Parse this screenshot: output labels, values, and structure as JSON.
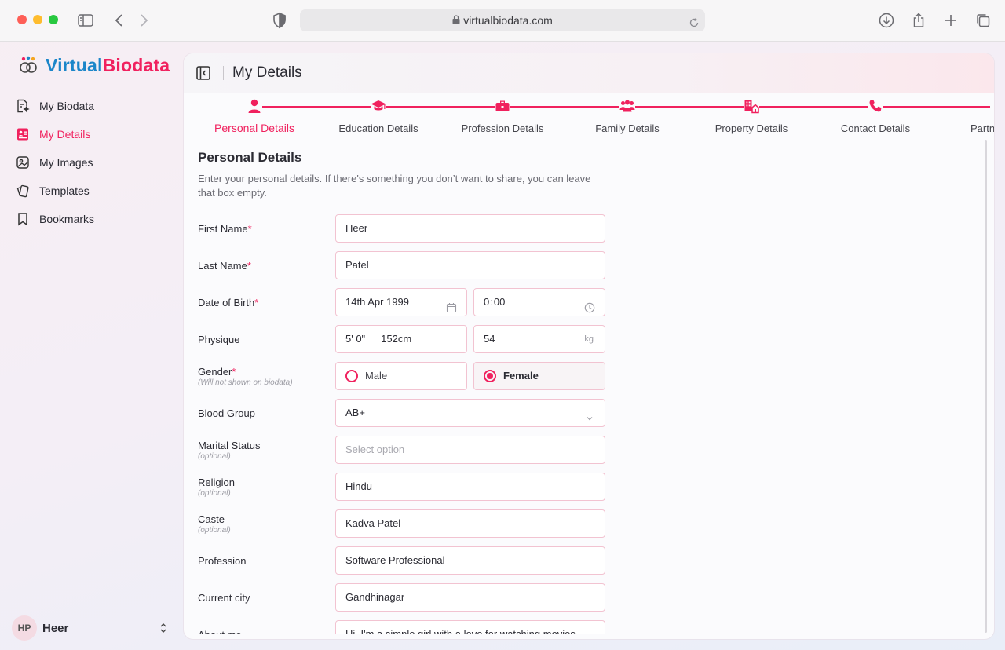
{
  "browser": {
    "url": "virtualbiodata.com"
  },
  "brand": {
    "part1": "Virtual",
    "part2": "Biodata"
  },
  "sidebar": {
    "items": [
      {
        "label": "My Biodata",
        "icon": "biodata-icon"
      },
      {
        "label": "My Details",
        "icon": "details-icon",
        "active": true
      },
      {
        "label": "My Images",
        "icon": "images-icon"
      },
      {
        "label": "Templates",
        "icon": "templates-icon"
      },
      {
        "label": "Bookmarks",
        "icon": "bookmark-icon"
      }
    ],
    "user": {
      "initials": "HP",
      "name": "Heer"
    }
  },
  "header": {
    "title": "My Details"
  },
  "steps": [
    {
      "label": "Personal Details",
      "icon": "person-icon",
      "active": true
    },
    {
      "label": "Education Details",
      "icon": "graduation-cap-icon"
    },
    {
      "label": "Profession Details",
      "icon": "briefcase-icon"
    },
    {
      "label": "Family Details",
      "icon": "family-icon"
    },
    {
      "label": "Property Details",
      "icon": "building-icon"
    },
    {
      "label": "Contact Details",
      "icon": "phone-icon"
    },
    {
      "label": "Partner",
      "icon": "partner-icon"
    }
  ],
  "form": {
    "title": "Personal Details",
    "description": "Enter your personal details. If there's something you don’t want to share, you can leave that box empty.",
    "required_mark": "*",
    "fields": {
      "first_name": {
        "label": "First Name",
        "value": "Heer"
      },
      "last_name": {
        "label": "Last Name",
        "value": "Patel"
      },
      "dob": {
        "label": "Date of Birth",
        "date": "14th Apr 1999",
        "time_hour": "0",
        "time_sep": ":",
        "time_min": "00"
      },
      "physique": {
        "label": "Physique",
        "height_ft": "5' 0\"",
        "height_cm": "152cm",
        "weight": "54",
        "weight_unit": "kg"
      },
      "gender": {
        "label": "Gender",
        "hint": "(Will not shown on biodata)",
        "option_male": "Male",
        "option_female": "Female",
        "selected": "Female"
      },
      "blood_group": {
        "label": "Blood Group",
        "value": "AB+"
      },
      "marital_status": {
        "label": "Marital Status",
        "hint": "(optional)",
        "placeholder": "Select option"
      },
      "religion": {
        "label": "Religion",
        "hint": "(optional)",
        "value": "Hindu"
      },
      "caste": {
        "label": "Caste",
        "hint": "(optional)",
        "value": "Kadva Patel"
      },
      "profession": {
        "label": "Profession",
        "value": "Software Professional"
      },
      "current_city": {
        "label": "Current city",
        "value": "Gandhinagar"
      },
      "about_me": {
        "label": "About me",
        "value": "Hi, I'm a simple girl with a love for watching movies"
      }
    }
  },
  "colors": {
    "accent": "#f0215e",
    "brand_blue": "#1c86c9",
    "field_border": "#f2c3d1"
  }
}
